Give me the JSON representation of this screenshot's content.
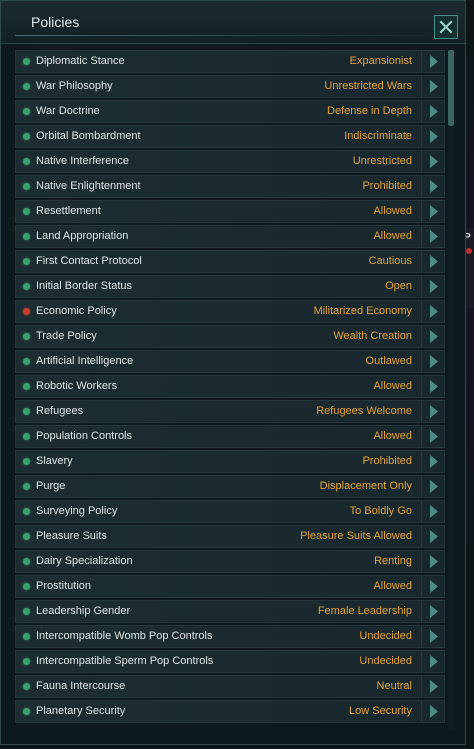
{
  "window": {
    "title": "Policies",
    "close_icon": "close-icon",
    "colors": {
      "value": "#e1a33a",
      "label": "#dfe6e6",
      "status_active": "#3aa070",
      "status_warning": "#c83a2e"
    }
  },
  "background_fragment": {
    "letter": "P"
  },
  "policies": [
    {
      "name": "Diplomatic Stance",
      "value": "Expansionist",
      "status": "green"
    },
    {
      "name": "War Philosophy",
      "value": "Unrestricted Wars",
      "status": "green"
    },
    {
      "name": "War Doctrine",
      "value": "Defense in Depth",
      "status": "green"
    },
    {
      "name": "Orbital Bombardment",
      "value": "Indiscriminate",
      "status": "green"
    },
    {
      "name": "Native Interference",
      "value": "Unrestricted",
      "status": "green"
    },
    {
      "name": "Native Enlightenment",
      "value": "Prohibited",
      "status": "green"
    },
    {
      "name": "Resettlement",
      "value": "Allowed",
      "status": "green"
    },
    {
      "name": "Land Appropriation",
      "value": "Allowed",
      "status": "green"
    },
    {
      "name": "First Contact Protocol",
      "value": "Cautious",
      "status": "green"
    },
    {
      "name": "Initial Border Status",
      "value": "Open",
      "status": "green"
    },
    {
      "name": "Economic Policy",
      "value": "Militarized Economy",
      "status": "red"
    },
    {
      "name": "Trade Policy",
      "value": "Wealth Creation",
      "status": "green"
    },
    {
      "name": "Artificial Intelligence",
      "value": "Outlawed",
      "status": "green"
    },
    {
      "name": "Robotic Workers",
      "value": "Allowed",
      "status": "green"
    },
    {
      "name": "Refugees",
      "value": "Refugees Welcome",
      "status": "green"
    },
    {
      "name": "Population Controls",
      "value": "Allowed",
      "status": "green"
    },
    {
      "name": "Slavery",
      "value": "Prohibited",
      "status": "green"
    },
    {
      "name": "Purge",
      "value": "Displacement Only",
      "status": "green"
    },
    {
      "name": "Surveying Policy",
      "value": "To Boldly Go",
      "status": "green"
    },
    {
      "name": "Pleasure Suits",
      "value": "Pleasure Suits Allowed",
      "status": "green"
    },
    {
      "name": "Dairy Specialization",
      "value": "Renting",
      "status": "green"
    },
    {
      "name": "Prostitution",
      "value": "Allowed",
      "status": "green"
    },
    {
      "name": "Leadership Gender",
      "value": "Female Leadership",
      "status": "green"
    },
    {
      "name": "Intercompatible Womb Pop Controls",
      "value": "Undecided",
      "status": "green"
    },
    {
      "name": "Intercompatible Sperm Pop Controls",
      "value": "Undecided",
      "status": "green"
    },
    {
      "name": "Fauna Intercourse",
      "value": "Neutral",
      "status": "green"
    },
    {
      "name": "Planetary Security",
      "value": "Low Security",
      "status": "green"
    }
  ]
}
